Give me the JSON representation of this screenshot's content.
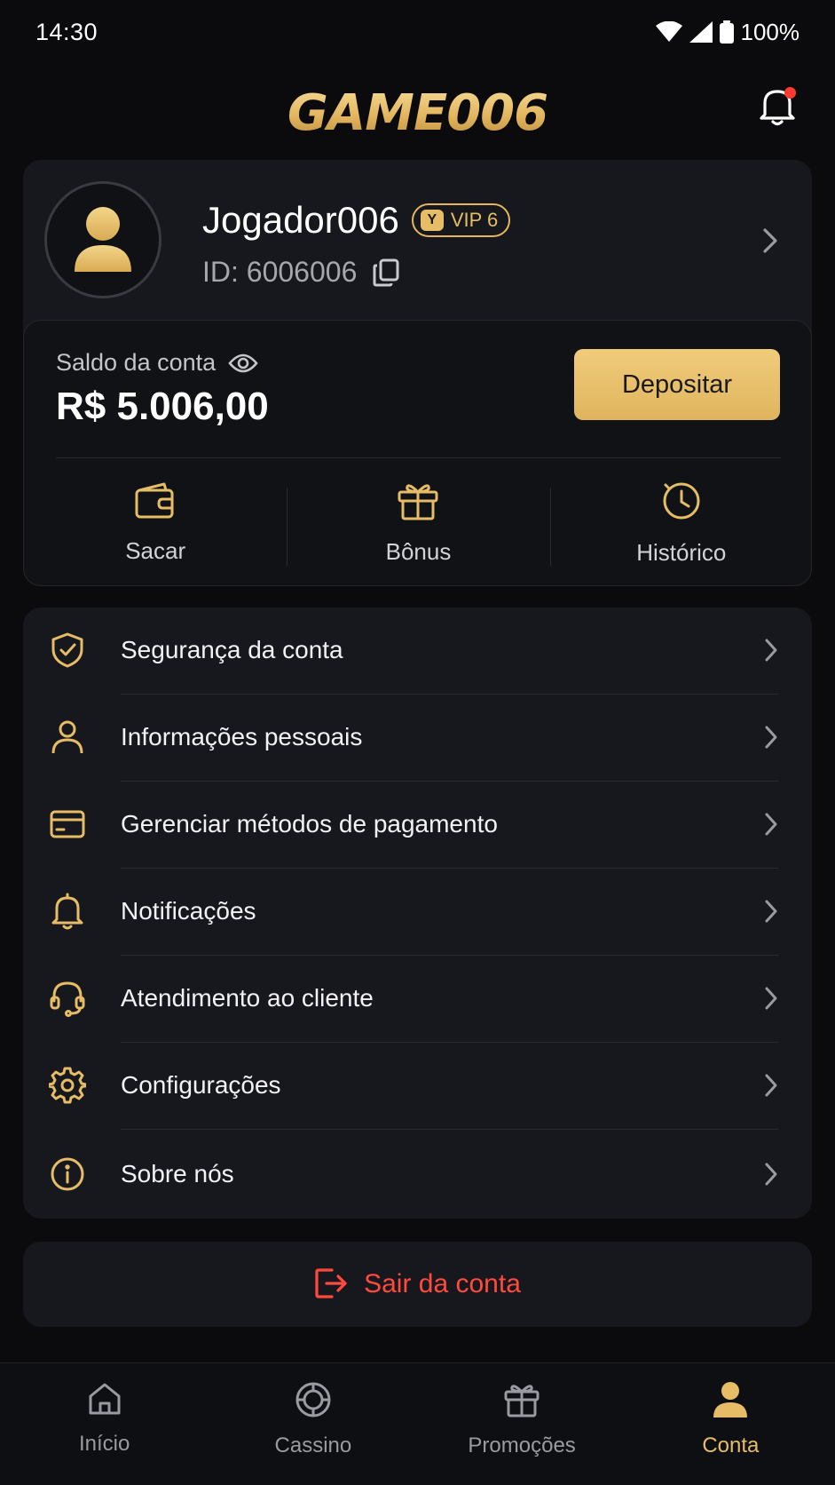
{
  "status_bar": {
    "time": "14:30",
    "battery": "100%"
  },
  "header": {
    "logo": "GAME006"
  },
  "profile": {
    "username": "Jogador006",
    "vip_icon_letter": "Y",
    "vip_label": "VIP 6",
    "id_text": "ID: 6006006"
  },
  "balance": {
    "label": "Saldo da conta",
    "value": "R$ 5.006,00",
    "deposit_label": "Depositar"
  },
  "quick_actions": [
    {
      "label": "Sacar",
      "icon": "wallet-icon"
    },
    {
      "label": "Bônus",
      "icon": "gift-icon"
    },
    {
      "label": "Histórico",
      "icon": "history-icon"
    }
  ],
  "menu": [
    {
      "label": "Segurança da conta",
      "icon": "shield-check-icon"
    },
    {
      "label": "Informações pessoais",
      "icon": "user-icon"
    },
    {
      "label": "Gerenciar métodos de pagamento",
      "icon": "credit-card-icon"
    },
    {
      "label": "Notificações",
      "icon": "bell-icon"
    },
    {
      "label": "Atendimento ao cliente",
      "icon": "headset-icon"
    },
    {
      "label": "Configurações",
      "icon": "gear-icon"
    },
    {
      "label": "Sobre nós",
      "icon": "info-icon"
    }
  ],
  "logout": {
    "label": "Sair da conta"
  },
  "bottom_nav": [
    {
      "label": "Início",
      "icon": "home-icon"
    },
    {
      "label": "Cassino",
      "icon": "casino-chip-icon"
    },
    {
      "label": "Promoções",
      "icon": "gift-icon"
    },
    {
      "label": "Conta",
      "icon": "user-icon",
      "active": true
    }
  ],
  "colors": {
    "background": "#0b0b0d",
    "card": "#17181d",
    "gold_accent": "#e6bd66",
    "danger": "#ff4a3d",
    "notification_dot": "#ff3b30"
  }
}
